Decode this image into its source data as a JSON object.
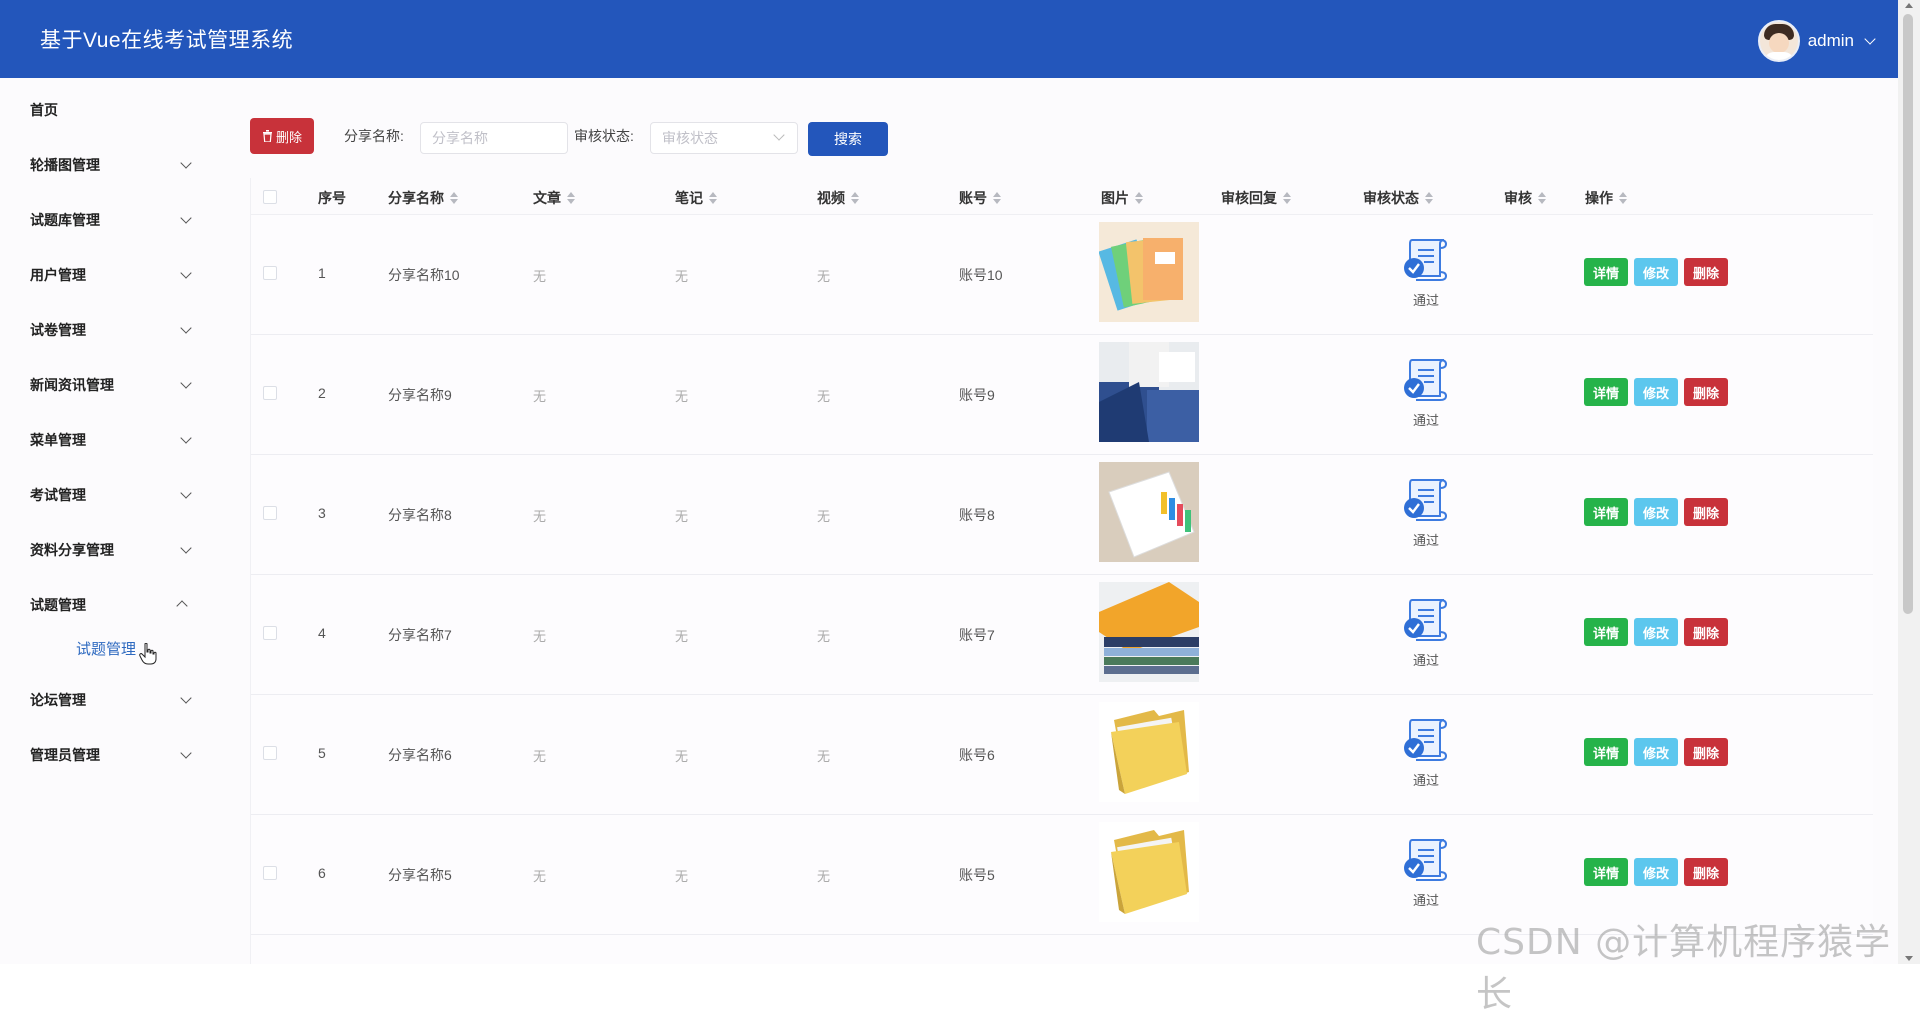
{
  "header": {
    "title": "基于Vue在线考试管理系统",
    "username": "admin"
  },
  "sidebar": {
    "items": [
      {
        "label": "首页"
      },
      {
        "label": "轮播图管理"
      },
      {
        "label": "试题库管理"
      },
      {
        "label": "用户管理"
      },
      {
        "label": "试卷管理"
      },
      {
        "label": "新闻资讯管理"
      },
      {
        "label": "菜单管理"
      },
      {
        "label": "考试管理"
      },
      {
        "label": "资料分享管理"
      },
      {
        "label": "试题管理"
      },
      {
        "label": "论坛管理"
      },
      {
        "label": "管理员管理"
      }
    ],
    "expanded_item": "试题管理",
    "submenu_label": "试题管理"
  },
  "toolbar": {
    "delete_label": "删除",
    "share_name_label": "分享名称:",
    "share_name_placeholder": "分享名称",
    "status_label": "审核状态:",
    "status_placeholder": "审核状态",
    "search_label": "搜索"
  },
  "table": {
    "columns": [
      "序号",
      "分享名称",
      "文章",
      "笔记",
      "视频",
      "账号",
      "图片",
      "审核回复",
      "审核状态",
      "审核",
      "操作"
    ],
    "rows": [
      {
        "index": "1",
        "name": "分享名称10",
        "article": "无",
        "note": "无",
        "video": "无",
        "account": "账号10",
        "image": "folders-colorful",
        "status": "通过"
      },
      {
        "index": "2",
        "name": "分享名称9",
        "article": "无",
        "note": "无",
        "video": "无",
        "account": "账号9",
        "image": "blue-files",
        "status": "通过"
      },
      {
        "index": "3",
        "name": "分享名称8",
        "article": "无",
        "note": "无",
        "video": "无",
        "account": "账号8",
        "image": "white-binder",
        "status": "通过"
      },
      {
        "index": "4",
        "name": "分享名称7",
        "article": "无",
        "note": "无",
        "video": "无",
        "account": "账号7",
        "image": "folder-stack",
        "status": "通过"
      },
      {
        "index": "5",
        "name": "分享名称6",
        "article": "无",
        "note": "无",
        "video": "无",
        "account": "账号6",
        "image": "yellow-folder",
        "status": "通过"
      },
      {
        "index": "6",
        "name": "分享名称5",
        "article": "无",
        "note": "无",
        "video": "无",
        "account": "账号5",
        "image": "yellow-folder",
        "status": "通过"
      }
    ],
    "actions": {
      "detail": "详情",
      "edit": "修改",
      "remove": "删除"
    }
  },
  "watermark": "CSDN @计算机程序猿学长",
  "colors": {
    "header_bg": "#2356bb",
    "danger": "#c8323a",
    "success": "#26b34a",
    "info": "#5cc7ee",
    "primary": "#2356bb"
  }
}
